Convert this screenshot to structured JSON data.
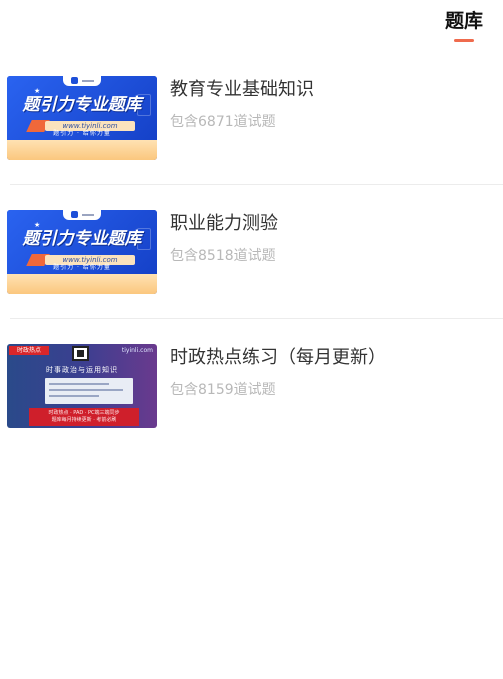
{
  "header": {
    "active_tab": "题库"
  },
  "items": [
    {
      "title": "教育专业基础知识",
      "subtitle": "包含6871道试题",
      "thumbnail": {
        "type": "brand-banner",
        "banner_title": "题引力专业题库",
        "url": "www.tiyinli.com",
        "tagline": "题引力 · 给你力量"
      }
    },
    {
      "title": "职业能力测验",
      "subtitle": "包含8518道试题",
      "thumbnail": {
        "type": "brand-banner",
        "banner_title": "题引力专业题库",
        "url": "www.tiyinli.com",
        "tagline": "题引力 · 给你力量"
      }
    },
    {
      "title": "时政热点练习（每月更新）",
      "subtitle": "包含8159道试题",
      "thumbnail": {
        "type": "news-banner",
        "badge": "时政热点",
        "site": "tiyinli.com",
        "headline": "时事政治与运用知识",
        "red_line1": "时政热点 · PAD · PC端三端同步",
        "red_line2": "题库每月持续更新 · 考前必刷"
      }
    }
  ],
  "colors": {
    "accent": "#ef6b4d",
    "title_text": "#333333",
    "subtitle_text": "#b8b8b8",
    "divider": "#ececec",
    "brand_blue": "#1d4fd8"
  }
}
